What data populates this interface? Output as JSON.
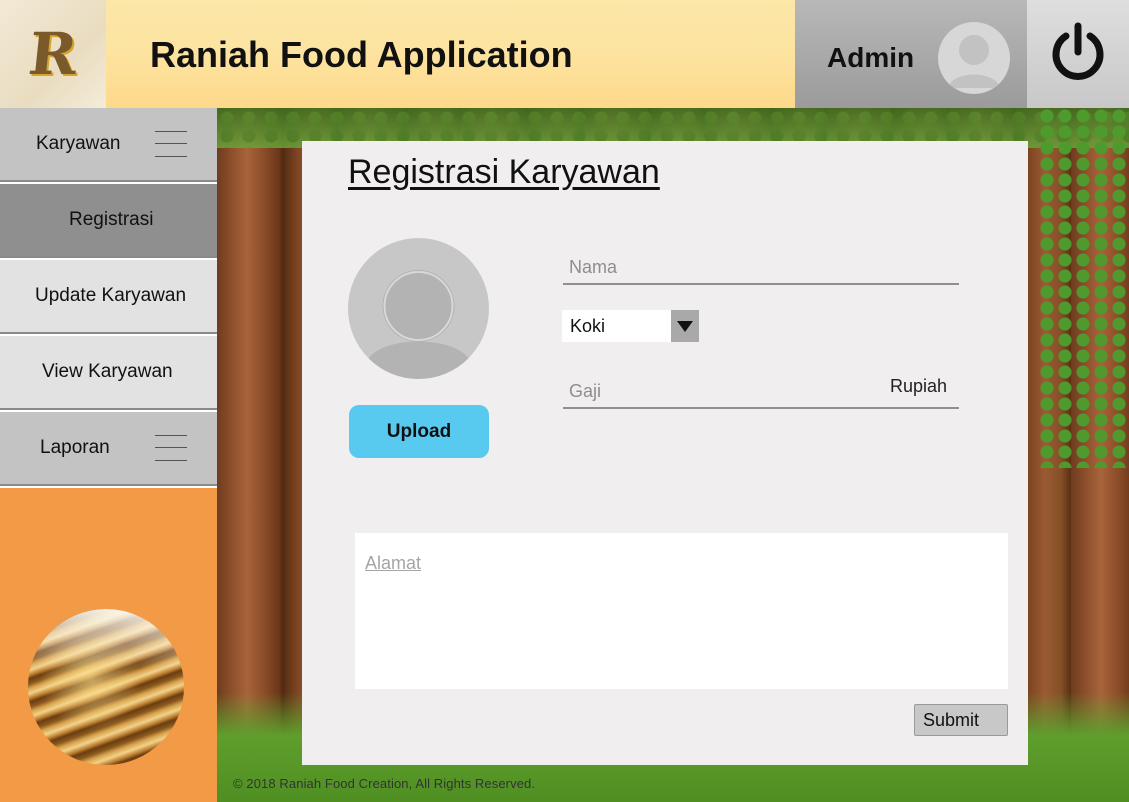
{
  "app": {
    "logo_letter": "R",
    "title": "Raniah Food Application"
  },
  "user": {
    "name": "Admin",
    "avatar_icon": "user-avatar-icon",
    "power_icon": "power-icon"
  },
  "sidebar": {
    "items": [
      {
        "label": "Karyawan",
        "has_menu_icon": true,
        "bg": "#c3c3c3"
      },
      {
        "label": "Registrasi",
        "has_menu_icon": false,
        "bg": "#8f8f8f",
        "active": true
      },
      {
        "label": "Update Karyawan",
        "has_menu_icon": false,
        "bg": "#e2e2e2"
      },
      {
        "label": "View Karyawan",
        "has_menu_icon": false,
        "bg": "#e2e2e2"
      },
      {
        "label": "Laporan",
        "has_menu_icon": true,
        "bg": "#c3c3c3"
      }
    ],
    "promo_bg": "#f39a47"
  },
  "form": {
    "title": "Registrasi Karyawan",
    "upload_label": "Upload",
    "nama_placeholder": "Nama",
    "jabatan_selected": "Koki",
    "gaji_placeholder": "Gaji",
    "gaji_unit": "Rupiah",
    "alamat_placeholder": "Alamat",
    "submit_label": "Submit"
  },
  "footer": {
    "text": "© 2018 Raniah Food Creation, All Rights Reserved."
  },
  "colors": {
    "header_yellow": "#fde3a0",
    "upload_blue": "#58c9ef",
    "card_bg": "#f0eeee"
  }
}
